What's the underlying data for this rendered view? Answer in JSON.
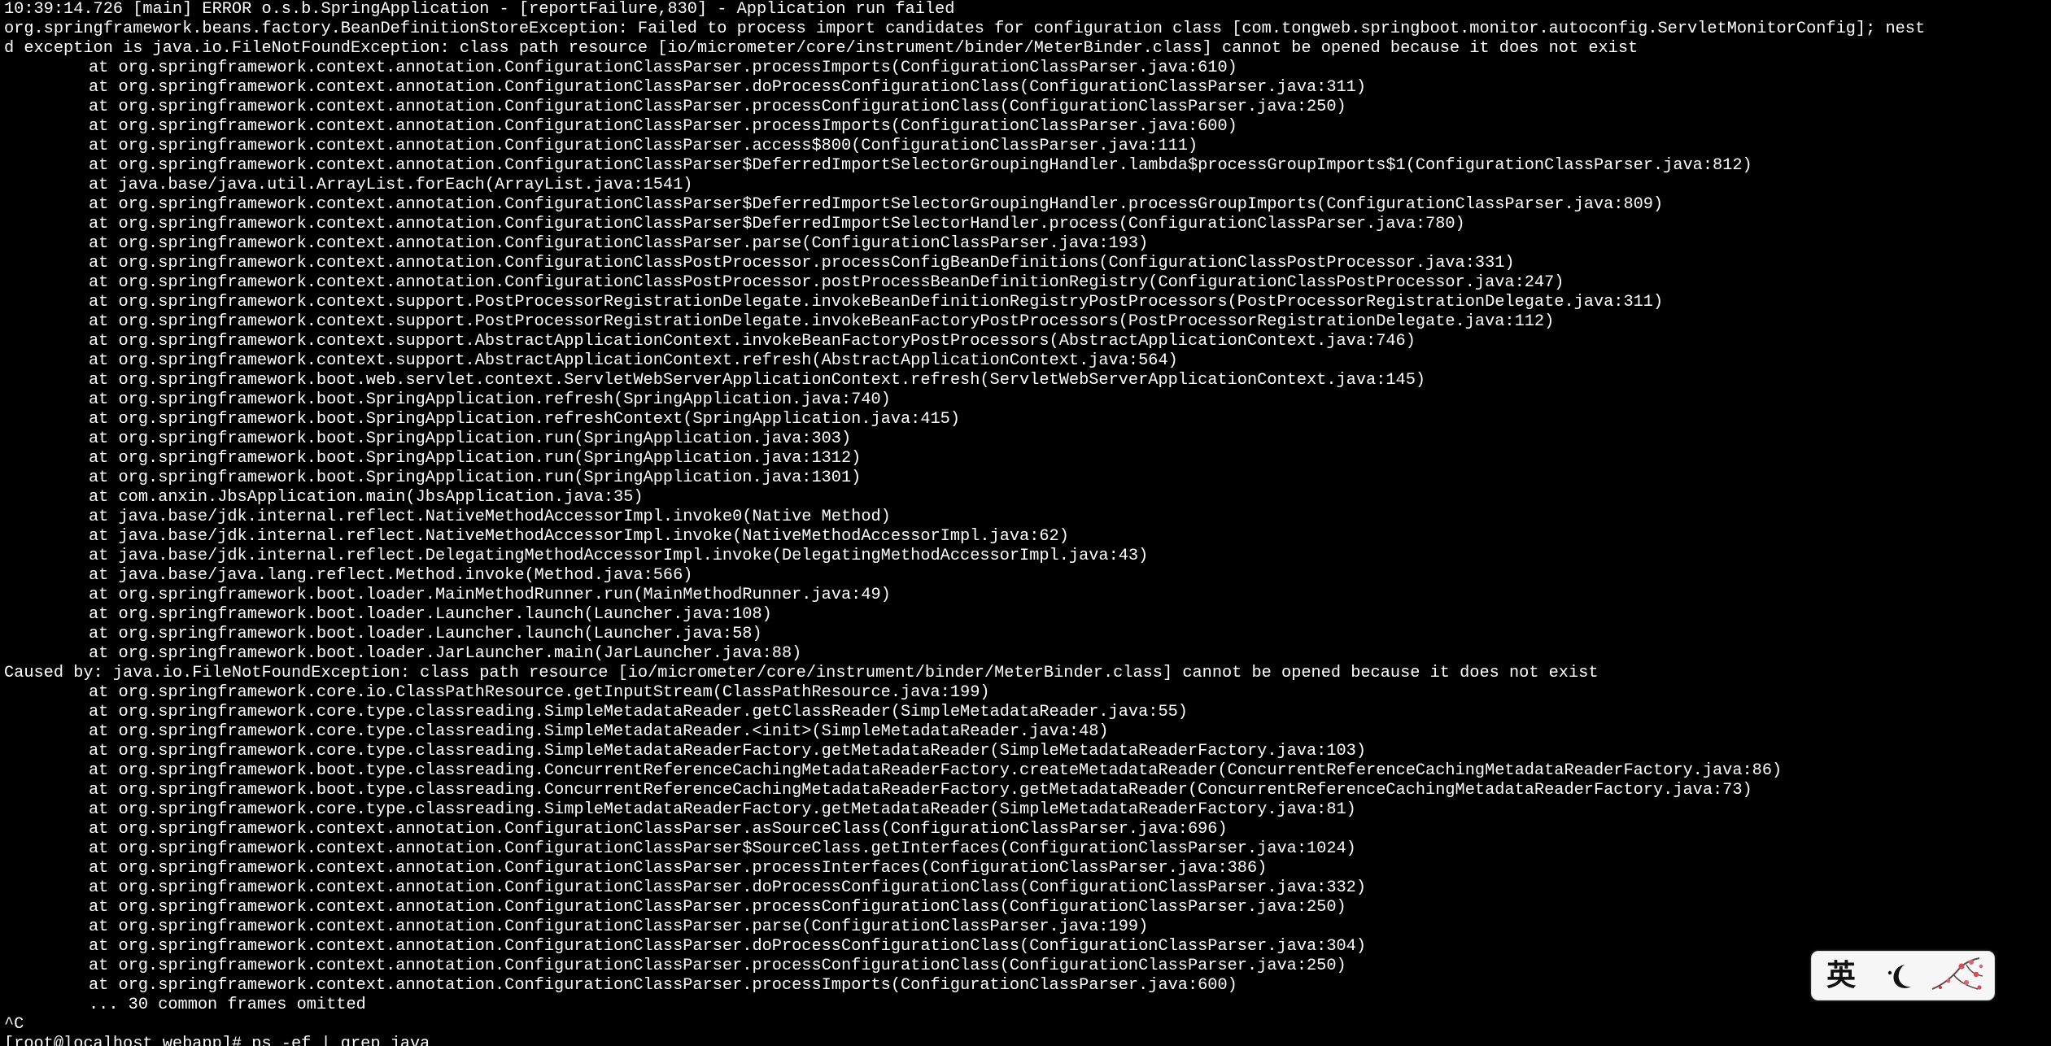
{
  "terminal": {
    "lines": [
      "10:39:14.726 [main] ERROR o.s.b.SpringApplication - [reportFailure,830] - Application run failed",
      "org.springframework.beans.factory.BeanDefinitionStoreException: Failed to process import candidates for configuration class [com.tongweb.springboot.monitor.autoconfig.ServletMonitorConfig]; nest",
      "d exception is java.io.FileNotFoundException: class path resource [io/micrometer/core/instrument/binder/MeterBinder.class] cannot be opened because it does not exist",
      "at org.springframework.context.annotation.ConfigurationClassParser.processImports(ConfigurationClassParser.java:610)",
      "at org.springframework.context.annotation.ConfigurationClassParser.doProcessConfigurationClass(ConfigurationClassParser.java:311)",
      "at org.springframework.context.annotation.ConfigurationClassParser.processConfigurationClass(ConfigurationClassParser.java:250)",
      "at org.springframework.context.annotation.ConfigurationClassParser.processImports(ConfigurationClassParser.java:600)",
      "at org.springframework.context.annotation.ConfigurationClassParser.access$800(ConfigurationClassParser.java:111)",
      "at org.springframework.context.annotation.ConfigurationClassParser$DeferredImportSelectorGroupingHandler.lambda$processGroupImports$1(ConfigurationClassParser.java:812)",
      "at java.base/java.util.ArrayList.forEach(ArrayList.java:1541)",
      "at org.springframework.context.annotation.ConfigurationClassParser$DeferredImportSelectorGroupingHandler.processGroupImports(ConfigurationClassParser.java:809)",
      "at org.springframework.context.annotation.ConfigurationClassParser$DeferredImportSelectorHandler.process(ConfigurationClassParser.java:780)",
      "at org.springframework.context.annotation.ConfigurationClassParser.parse(ConfigurationClassParser.java:193)",
      "at org.springframework.context.annotation.ConfigurationClassPostProcessor.processConfigBeanDefinitions(ConfigurationClassPostProcessor.java:331)",
      "at org.springframework.context.annotation.ConfigurationClassPostProcessor.postProcessBeanDefinitionRegistry(ConfigurationClassPostProcessor.java:247)",
      "at org.springframework.context.support.PostProcessorRegistrationDelegate.invokeBeanDefinitionRegistryPostProcessors(PostProcessorRegistrationDelegate.java:311)",
      "at org.springframework.context.support.PostProcessorRegistrationDelegate.invokeBeanFactoryPostProcessors(PostProcessorRegistrationDelegate.java:112)",
      "at org.springframework.context.support.AbstractApplicationContext.invokeBeanFactoryPostProcessors(AbstractApplicationContext.java:746)",
      "at org.springframework.context.support.AbstractApplicationContext.refresh(AbstractApplicationContext.java:564)",
      "at org.springframework.boot.web.servlet.context.ServletWebServerApplicationContext.refresh(ServletWebServerApplicationContext.java:145)",
      "at org.springframework.boot.SpringApplication.refresh(SpringApplication.java:740)",
      "at org.springframework.boot.SpringApplication.refreshContext(SpringApplication.java:415)",
      "at org.springframework.boot.SpringApplication.run(SpringApplication.java:303)",
      "at org.springframework.boot.SpringApplication.run(SpringApplication.java:1312)",
      "at org.springframework.boot.SpringApplication.run(SpringApplication.java:1301)",
      "at com.anxin.JbsApplication.main(JbsApplication.java:35)",
      "at java.base/jdk.internal.reflect.NativeMethodAccessorImpl.invoke0(Native Method)",
      "at java.base/jdk.internal.reflect.NativeMethodAccessorImpl.invoke(NativeMethodAccessorImpl.java:62)",
      "at java.base/jdk.internal.reflect.DelegatingMethodAccessorImpl.invoke(DelegatingMethodAccessorImpl.java:43)",
      "at java.base/java.lang.reflect.Method.invoke(Method.java:566)",
      "at org.springframework.boot.loader.MainMethodRunner.run(MainMethodRunner.java:49)",
      "at org.springframework.boot.loader.Launcher.launch(Launcher.java:108)",
      "at org.springframework.boot.loader.Launcher.launch(Launcher.java:58)",
      "at org.springframework.boot.loader.JarLauncher.main(JarLauncher.java:88)",
      "Caused by: java.io.FileNotFoundException: class path resource [io/micrometer/core/instrument/binder/MeterBinder.class] cannot be opened because it does not exist",
      "at org.springframework.core.io.ClassPathResource.getInputStream(ClassPathResource.java:199)",
      "at org.springframework.core.type.classreading.SimpleMetadataReader.getClassReader(SimpleMetadataReader.java:55)",
      "at org.springframework.core.type.classreading.SimpleMetadataReader.<init>(SimpleMetadataReader.java:48)",
      "at org.springframework.core.type.classreading.SimpleMetadataReaderFactory.getMetadataReader(SimpleMetadataReaderFactory.java:103)",
      "at org.springframework.boot.type.classreading.ConcurrentReferenceCachingMetadataReaderFactory.createMetadataReader(ConcurrentReferenceCachingMetadataReaderFactory.java:86)",
      "at org.springframework.boot.type.classreading.ConcurrentReferenceCachingMetadataReaderFactory.getMetadataReader(ConcurrentReferenceCachingMetadataReaderFactory.java:73)",
      "at org.springframework.core.type.classreading.SimpleMetadataReaderFactory.getMetadataReader(SimpleMetadataReaderFactory.java:81)",
      "at org.springframework.context.annotation.ConfigurationClassParser.asSourceClass(ConfigurationClassParser.java:696)",
      "at org.springframework.context.annotation.ConfigurationClassParser$SourceClass.getInterfaces(ConfigurationClassParser.java:1024)",
      "at org.springframework.context.annotation.ConfigurationClassParser.processInterfaces(ConfigurationClassParser.java:386)",
      "at org.springframework.context.annotation.ConfigurationClassParser.doProcessConfigurationClass(ConfigurationClassParser.java:332)",
      "at org.springframework.context.annotation.ConfigurationClassParser.processConfigurationClass(ConfigurationClassParser.java:250)",
      "at org.springframework.context.annotation.ConfigurationClassParser.parse(ConfigurationClassParser.java:199)",
      "at org.springframework.context.annotation.ConfigurationClassParser.doProcessConfigurationClass(ConfigurationClassParser.java:304)",
      "at org.springframework.context.annotation.ConfigurationClassParser.processConfigurationClass(ConfigurationClassParser.java:250)",
      "at org.springframework.context.annotation.ConfigurationClassParser.processImports(ConfigurationClassParser.java:600)",
      "... 30 common frames omitted",
      "^C",
      "[root@localhost webapp]# ps -ef | grep java"
    ]
  },
  "ime_toolbar": {
    "mode_label": "英",
    "moon_icon": "crescent-moon-icon",
    "skin_icon": "plum-blossom-skin-icon"
  },
  "colors": {
    "background": "#000000",
    "foreground": "#ffffff"
  }
}
